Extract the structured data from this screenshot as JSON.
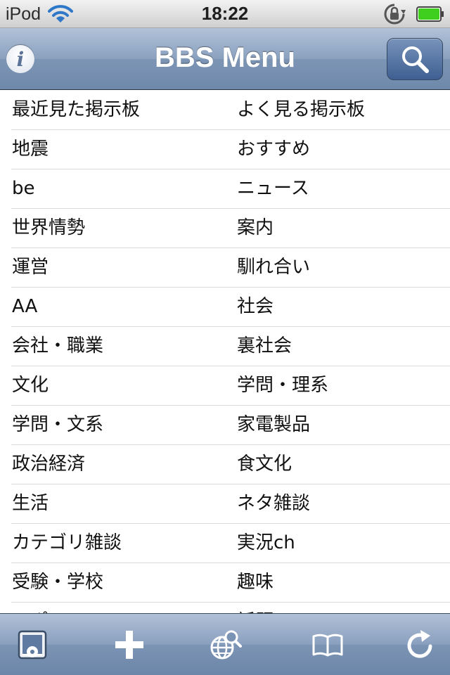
{
  "status_bar": {
    "device": "iPod",
    "time": "18:22"
  },
  "nav": {
    "title": "BBS Menu"
  },
  "boards": [
    {
      "left": "最近見た掲示板",
      "right": "よく見る掲示板"
    },
    {
      "left": "地震",
      "right": "おすすめ"
    },
    {
      "left": "be",
      "right": "ニュース"
    },
    {
      "left": "世界情勢",
      "right": "案内"
    },
    {
      "left": "運営",
      "right": "馴れ合い"
    },
    {
      "left": "AA",
      "right": "社会"
    },
    {
      "left": "会社・職業",
      "right": "裏社会"
    },
    {
      "left": "文化",
      "right": "学問・理系"
    },
    {
      "left": "学問・文系",
      "right": "家電製品"
    },
    {
      "left": "政治経済",
      "right": "食文化"
    },
    {
      "left": "生活",
      "right": "ネタ雑談"
    },
    {
      "left": "カテゴリ雑談",
      "right": "実況ch"
    },
    {
      "left": "受験・学校",
      "right": "趣味"
    },
    {
      "left": "スポーツ",
      "right": "話題"
    }
  ],
  "icons": {
    "wifi": "wifi-icon",
    "lock": "rotation-lock-icon",
    "battery": "battery-icon",
    "info": "info-icon",
    "search": "search-icon",
    "toolbar": [
      "image-settings-icon",
      "plus-icon",
      "globe-search-icon",
      "book-icon",
      "refresh-icon"
    ]
  },
  "colors": {
    "battery_fill": "#3fcf1e",
    "nav_text": "#ffffff",
    "divider": "#d9d9d9"
  }
}
